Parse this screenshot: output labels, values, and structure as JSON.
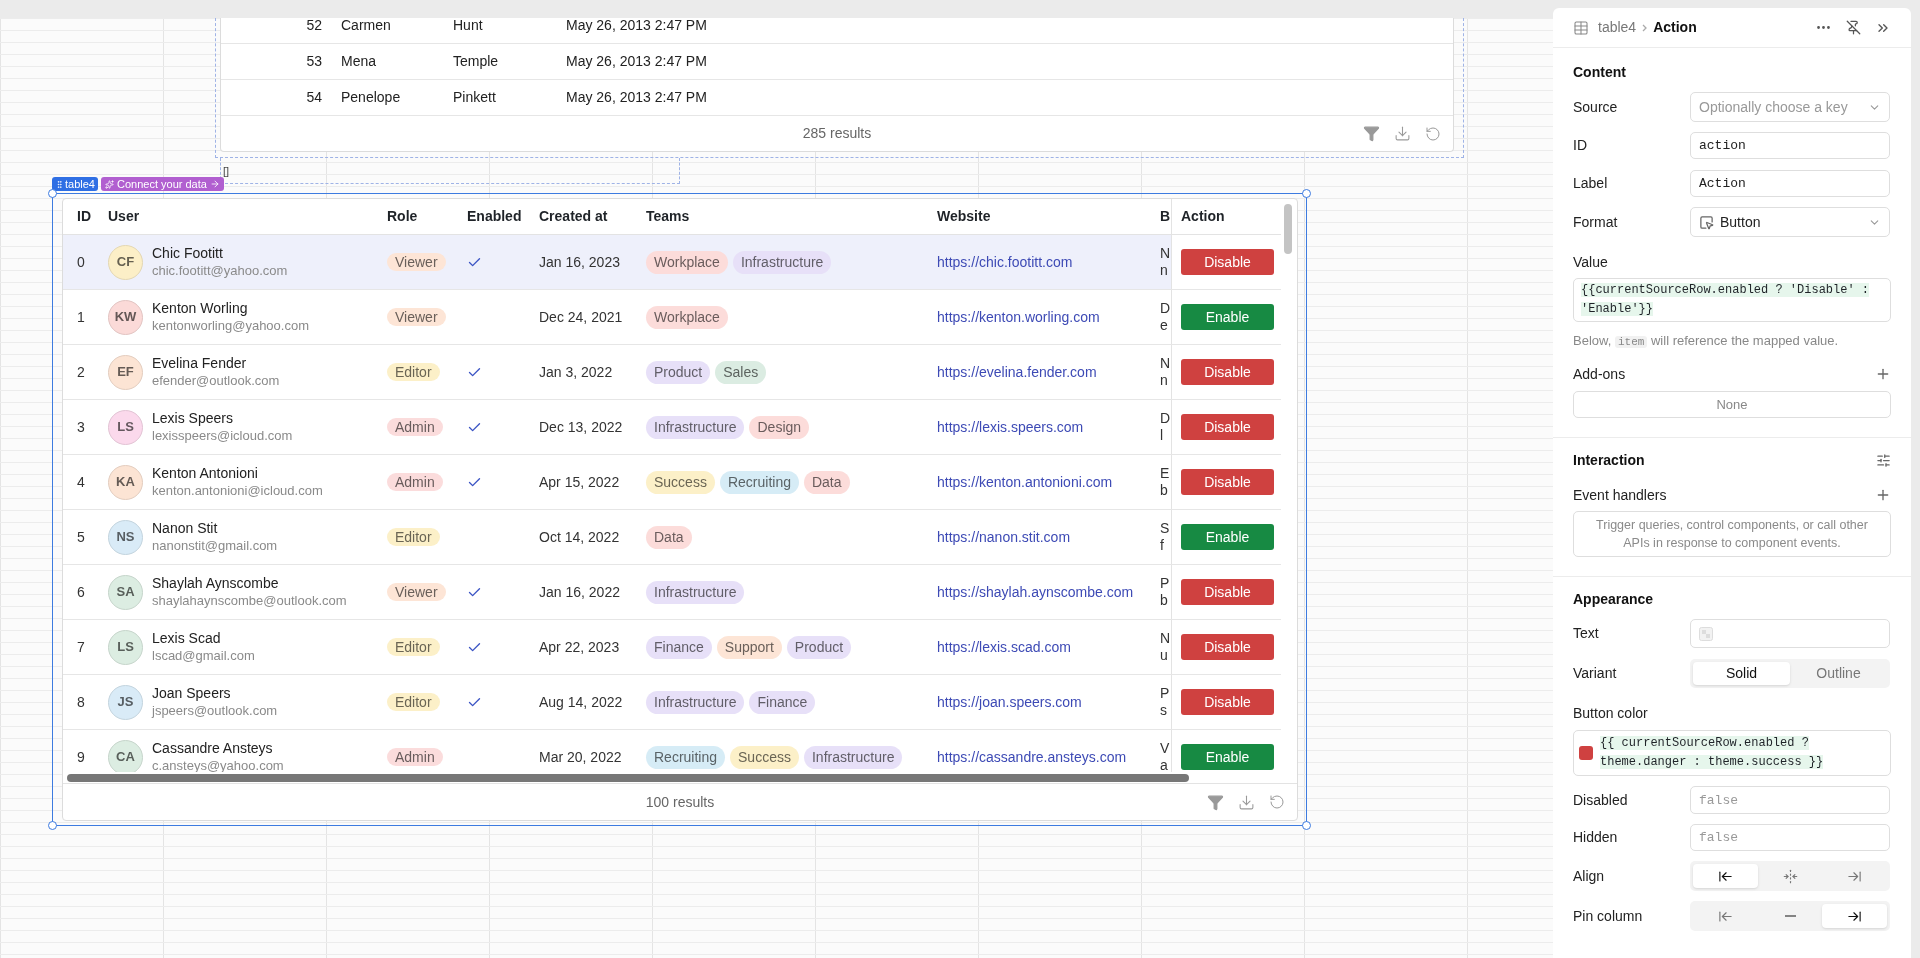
{
  "top_table": {
    "rows": [
      {
        "id": "52",
        "first_name": "Carmen",
        "last_name": "Hunt",
        "created": "May 26, 2013 2:47 PM"
      },
      {
        "id": "53",
        "first_name": "Mena",
        "last_name": "Temple",
        "created": "May 26, 2013 2:47 PM"
      },
      {
        "id": "54",
        "first_name": "Penelope",
        "last_name": "Pinkett",
        "created": "May 26, 2013 2:47 PM"
      }
    ],
    "footer": "285 results"
  },
  "placeholder_box": {
    "text": "[]"
  },
  "table4": {
    "tag": "table4",
    "connect_label": "Connect your data",
    "columns": [
      "ID",
      "User",
      "Role",
      "Enabled",
      "Created at",
      "Teams",
      "Website",
      "B",
      "Action"
    ],
    "rows": [
      {
        "id": "0",
        "initials": "CF",
        "color": "#fcefc7",
        "name": "Chic Footitt",
        "email": "chic.footitt@yahoo.com",
        "role": {
          "label": "Viewer",
          "color": "#fde5d6"
        },
        "enabled": true,
        "created": "Jan 16, 2023",
        "teams": [
          {
            "label": "Workplace",
            "color": "#fcdcda"
          },
          {
            "label": "Infrastructure",
            "color": "#e7e0f8"
          }
        ],
        "website": "https://chic.footitt.com",
        "column_8": [
          "N",
          "n"
        ],
        "action": "Disable",
        "selected": true
      },
      {
        "id": "1",
        "initials": "KW",
        "color": "#fbdad8",
        "name": "Kenton Worling",
        "email": "kentonworling@yahoo.com",
        "role": {
          "label": "Viewer",
          "color": "#fde5d6"
        },
        "enabled": false,
        "created": "Dec 24, 2021",
        "teams": [
          {
            "label": "Workplace",
            "color": "#fcdcda"
          }
        ],
        "website": "https://kenton.worling.com",
        "column_8": [
          "D",
          "e"
        ],
        "action": "Enable",
        "selected": false
      },
      {
        "id": "2",
        "initials": "EF",
        "color": "#fce4d4",
        "name": "Evelina Fender",
        "email": "efender@outlook.com",
        "role": {
          "label": "Editor",
          "color": "#fcf0c8"
        },
        "enabled": true,
        "created": "Jan 3, 2022",
        "teams": [
          {
            "label": "Product",
            "color": "#e7e0f8"
          },
          {
            "label": "Sales",
            "color": "#dbece2"
          }
        ],
        "website": "https://evelina.fender.com",
        "column_8": [
          "N",
          "n"
        ],
        "action": "Disable",
        "selected": false
      },
      {
        "id": "3",
        "initials": "LS",
        "color": "#fbd9ec",
        "name": "Lexis Speers",
        "email": "lexisspeers@icloud.com",
        "role": {
          "label": "Admin",
          "color": "#fbdcdc"
        },
        "enabled": true,
        "created": "Dec 13, 2022",
        "teams": [
          {
            "label": "Infrastructure",
            "color": "#e7e0f8"
          },
          {
            "label": "Design",
            "color": "#fcdcda"
          }
        ],
        "website": "https://lexis.speers.com",
        "column_8": [
          "D",
          "l"
        ],
        "action": "Disable",
        "selected": false
      },
      {
        "id": "4",
        "initials": "KA",
        "color": "#fce4d4",
        "name": "Kenton Antonioni",
        "email": "kenton.antonioni@icloud.com",
        "role": {
          "label": "Admin",
          "color": "#fbdcdc"
        },
        "enabled": true,
        "created": "Apr 15, 2022",
        "teams": [
          {
            "label": "Success",
            "color": "#fcf0c8"
          },
          {
            "label": "Recruiting",
            "color": "#d6ecf6"
          },
          {
            "label": "Data",
            "color": "#fcdcda"
          }
        ],
        "website": "https://kenton.antonioni.com",
        "column_8": [
          "E",
          "b"
        ],
        "action": "Disable",
        "selected": false
      },
      {
        "id": "5",
        "initials": "NS",
        "color": "#d9ebf7",
        "name": "Nanon Stit",
        "email": "nanonstit@gmail.com",
        "role": {
          "label": "Editor",
          "color": "#fcf0c8"
        },
        "enabled": false,
        "created": "Oct 14, 2022",
        "teams": [
          {
            "label": "Data",
            "color": "#fcdcda"
          }
        ],
        "website": "https://nanon.stit.com",
        "column_8": [
          "S",
          "f"
        ],
        "action": "Enable",
        "selected": false
      },
      {
        "id": "6",
        "initials": "SA",
        "color": "#dcede2",
        "name": "Shaylah Aynscombe",
        "email": "shaylahaynscombe@outlook.com",
        "role": {
          "label": "Viewer",
          "color": "#fde5d6"
        },
        "enabled": true,
        "created": "Jan 16, 2022",
        "teams": [
          {
            "label": "Infrastructure",
            "color": "#e7e0f8"
          }
        ],
        "website": "https://shaylah.aynscombe.com",
        "column_8": [
          "P",
          "b"
        ],
        "action": "Disable",
        "selected": false
      },
      {
        "id": "7",
        "initials": "LS",
        "color": "#dcede2",
        "name": "Lexis Scad",
        "email": "lscad@gmail.com",
        "role": {
          "label": "Editor",
          "color": "#fcf0c8"
        },
        "enabled": true,
        "created": "Apr 22, 2023",
        "teams": [
          {
            "label": "Finance",
            "color": "#e7e0f8"
          },
          {
            "label": "Support",
            "color": "#fde5d6"
          },
          {
            "label": "Product",
            "color": "#e7e0f8"
          }
        ],
        "website": "https://lexis.scad.com",
        "column_8": [
          "N",
          "u"
        ],
        "action": "Disable",
        "selected": false
      },
      {
        "id": "8",
        "initials": "JS",
        "color": "#d9ebf7",
        "name": "Joan Speers",
        "email": "jspeers@outlook.com",
        "role": {
          "label": "Editor",
          "color": "#fcf0c8"
        },
        "enabled": true,
        "created": "Aug 14, 2022",
        "teams": [
          {
            "label": "Infrastructure",
            "color": "#e7e0f8"
          },
          {
            "label": "Finance",
            "color": "#e7e0f8"
          }
        ],
        "website": "https://joan.speers.com",
        "column_8": [
          "P",
          "s"
        ],
        "action": "Disable",
        "selected": false
      },
      {
        "id": "9",
        "initials": "CA",
        "color": "#dcede2",
        "name": "Cassandre Ansteys",
        "email": "c.ansteys@yahoo.com",
        "role": {
          "label": "Admin",
          "color": "#fbdcdc"
        },
        "enabled": false,
        "created": "Mar 20, 2022",
        "teams": [
          {
            "label": "Recruiting",
            "color": "#d6ecf6"
          },
          {
            "label": "Success",
            "color": "#fcf0c8"
          },
          {
            "label": "Infrastructure",
            "color": "#e7e0f8"
          }
        ],
        "website": "https://cassandre.ansteys.com",
        "column_8": [
          "V",
          "a"
        ],
        "action": "Enable",
        "selected": false
      }
    ],
    "footer": "100 results"
  },
  "inspector": {
    "breadcrumb": {
      "parent": "table4",
      "current": "Action"
    },
    "content": {
      "title": "Content",
      "source": {
        "label": "Source",
        "placeholder": "Optionally choose a key"
      },
      "id": {
        "label": "ID",
        "value": "action"
      },
      "label": {
        "label": "Label",
        "value": "Action"
      },
      "format": {
        "label": "Format",
        "value": "Button"
      },
      "value": {
        "label": "Value",
        "code": "{{currentSourceRow.enabled ? 'Disable' : 'Enable'}}"
      },
      "hint": {
        "before": "Below,",
        "code": "item",
        "after": "will reference the mapped value."
      },
      "addons": {
        "label": "Add-ons",
        "empty": "None"
      }
    },
    "interaction": {
      "title": "Interaction",
      "event_handlers": {
        "label": "Event handlers",
        "empty": "Trigger queries, control components, or call other APIs in response to component events."
      }
    },
    "appearance": {
      "title": "Appearance",
      "text": {
        "label": "Text"
      },
      "variant": {
        "label": "Variant",
        "options": [
          {
            "label": "Solid",
            "selected": true
          },
          {
            "label": "Outline",
            "selected": false
          }
        ]
      },
      "button_color": {
        "label": "Button color",
        "color": "#cf4140",
        "code": "{{ currentSourceRow.enabled ? theme.danger : theme.success }}"
      },
      "disabled": {
        "label": "Disabled",
        "placeholder": "false"
      },
      "hidden": {
        "label": "Hidden",
        "placeholder": "false"
      },
      "align": {
        "label": "Align",
        "options": [
          {
            "kind": "left",
            "selected": true
          },
          {
            "kind": "center",
            "selected": false
          },
          {
            "kind": "right",
            "selected": false
          }
        ]
      },
      "pin_column": {
        "label": "Pin column",
        "options": [
          {
            "kind": "left",
            "selected": false
          },
          {
            "kind": "none",
            "selected": false
          },
          {
            "kind": "right",
            "selected": true
          }
        ]
      }
    }
  }
}
